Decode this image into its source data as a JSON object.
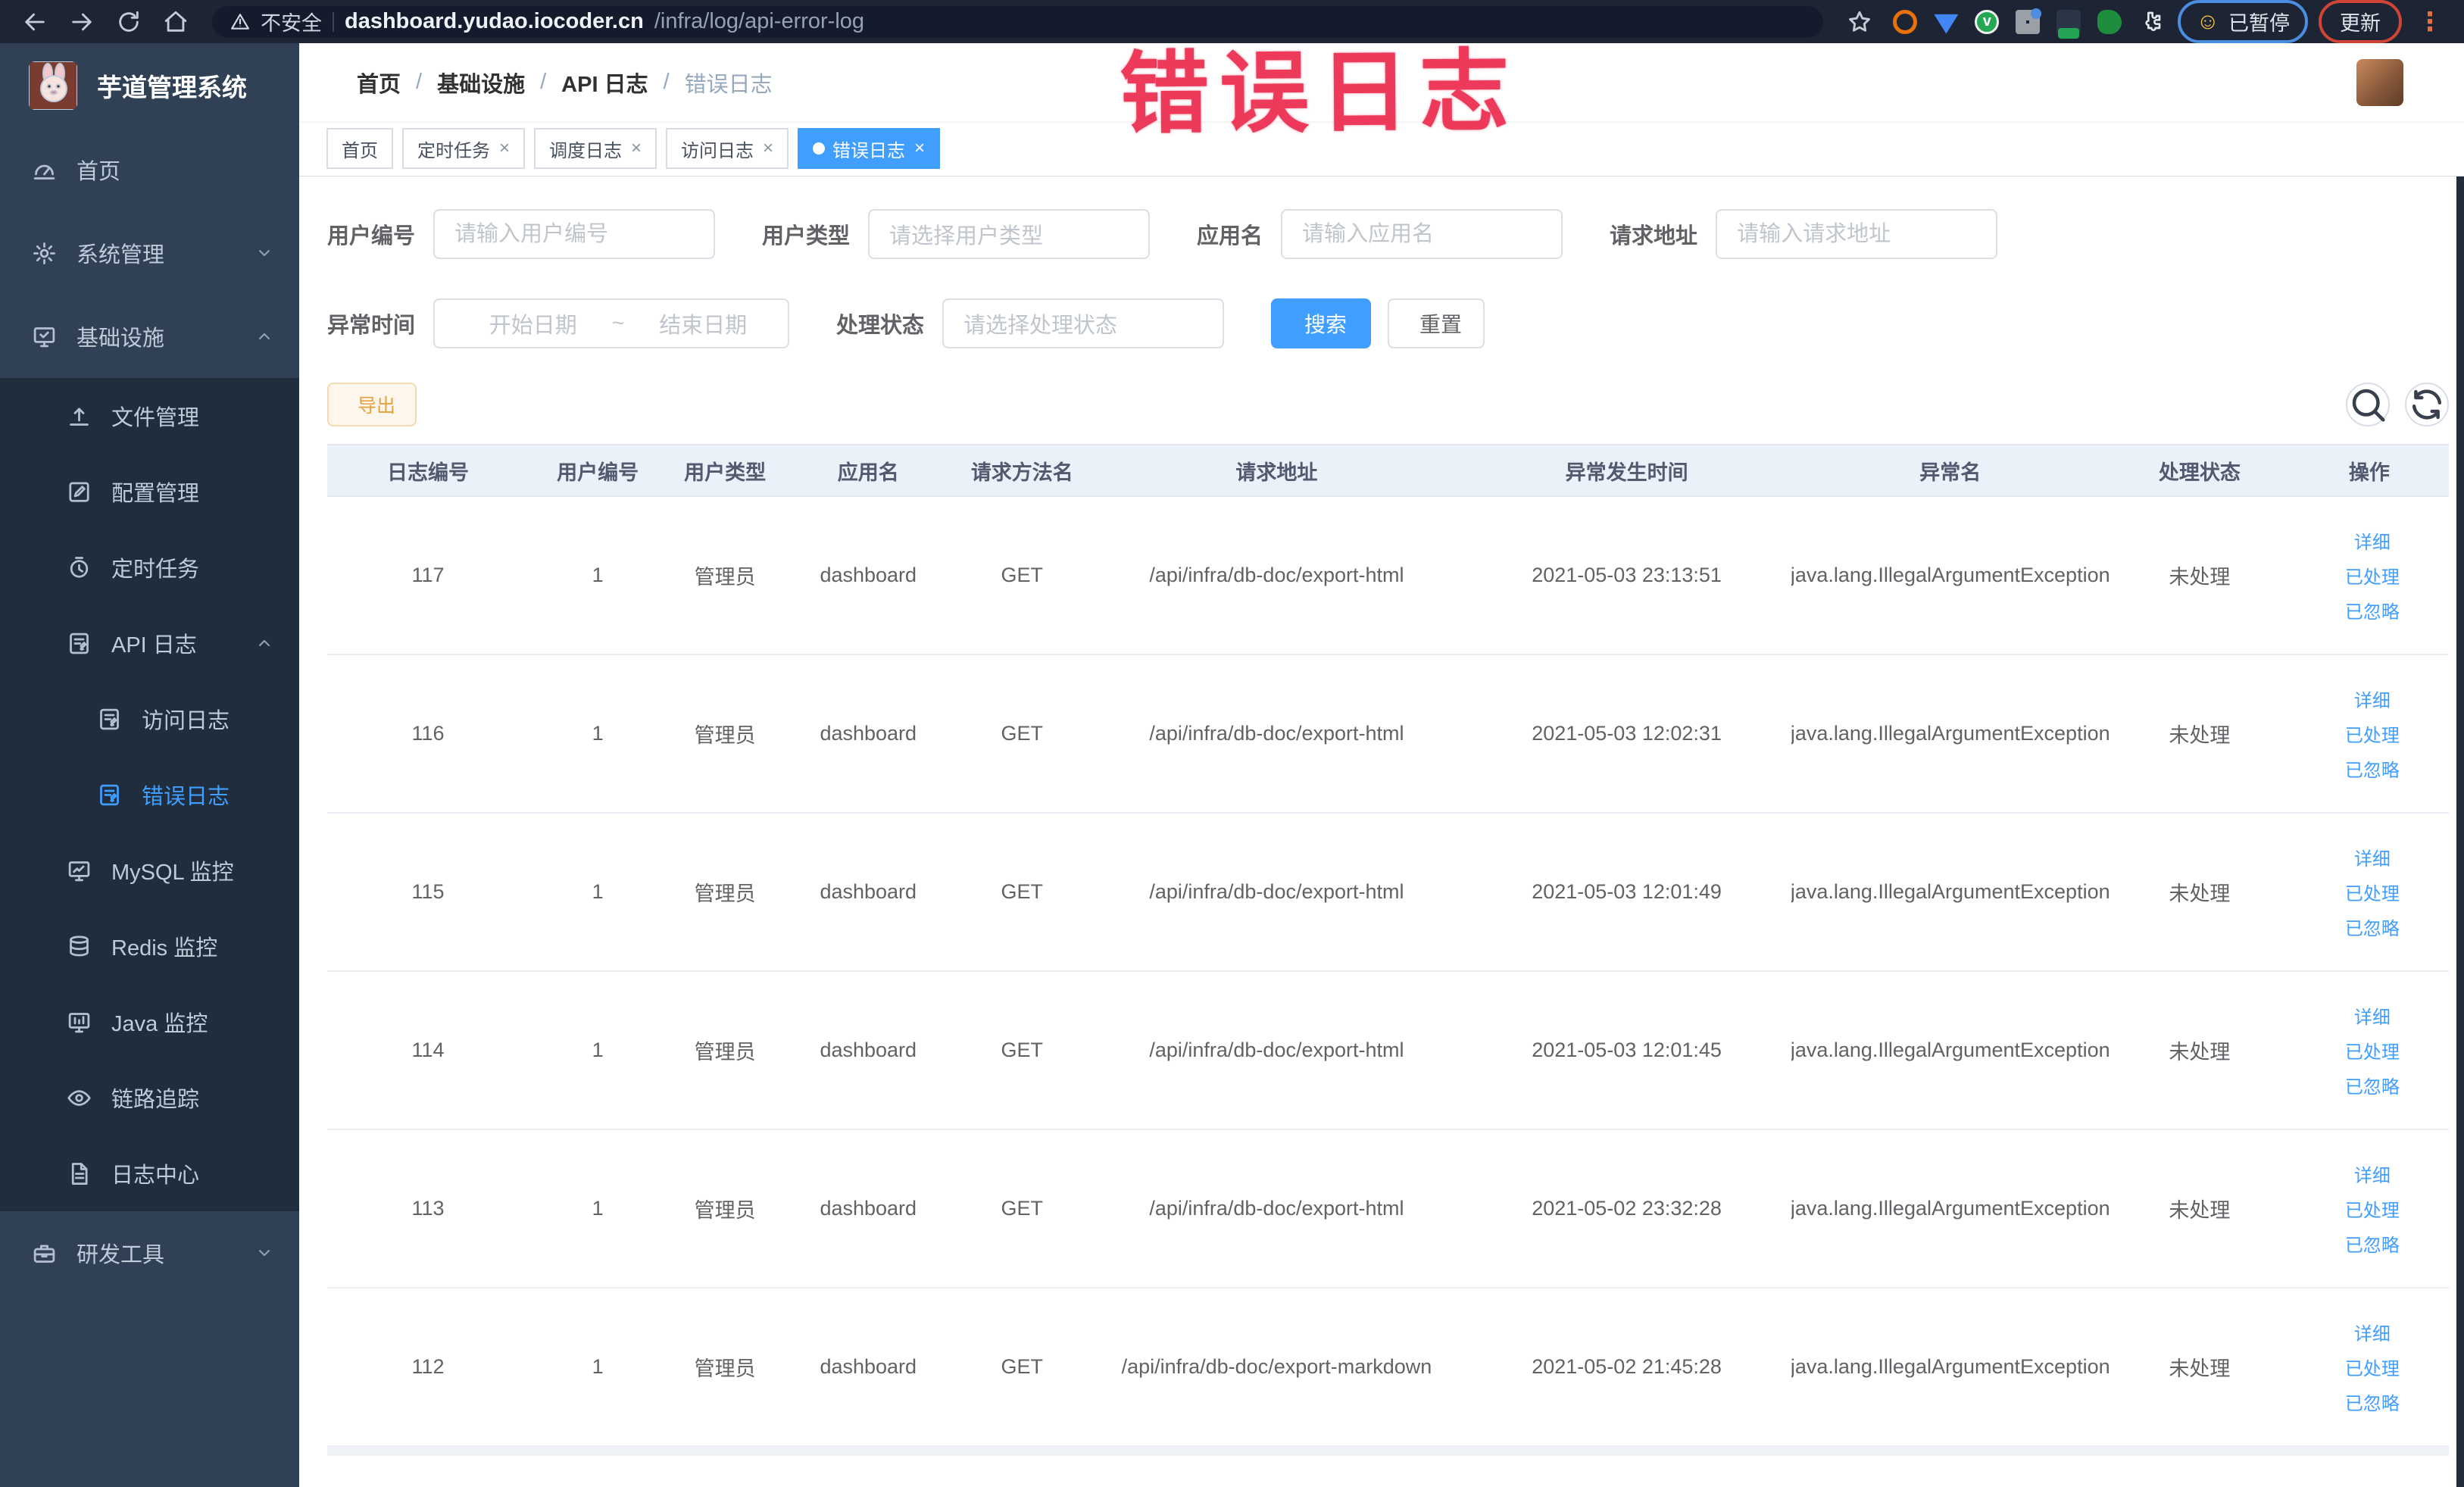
{
  "browser": {
    "security_label": "不安全",
    "url_host": "dashboard.yudao.iocoder.cn",
    "url_path": "/infra/log/api-error-log",
    "paused_emoji": "☺",
    "paused_label": "已暂停",
    "update_label": "更新",
    "kebab": "⋮"
  },
  "annotation": "错误日志",
  "colors": {
    "accent": "#409eff",
    "chrome_bg": "#1d2535",
    "sidebar_bg": "#304156",
    "sidebar_submenu_bg": "#1f2d3d",
    "sidebar_text": "#bfcbd9",
    "table_header_bg": "#ebf1f9",
    "export_bg": "#fdf6ec",
    "export_border": "#f5dab1",
    "export_text": "#e6a23c",
    "tag_active_bg": "#409eff",
    "annotation_color": "#ee3a5a"
  },
  "sidebar": {
    "app_title": "芋道管理系统",
    "items": [
      {
        "key": "home",
        "label": "首页",
        "icon": "dashboard-icon",
        "level": 1
      },
      {
        "key": "system",
        "label": "系统管理",
        "icon": "gear-icon",
        "level": 1,
        "chevron": "down"
      },
      {
        "key": "infra",
        "label": "基础设施",
        "icon": "monitor-icon",
        "level": 1,
        "chevron": "up"
      },
      {
        "key": "file",
        "label": "文件管理",
        "icon": "upload-icon",
        "level": 2,
        "dark": true
      },
      {
        "key": "config",
        "label": "配置管理",
        "icon": "edit-icon",
        "level": 2,
        "dark": true
      },
      {
        "key": "job",
        "label": "定时任务",
        "icon": "timer-icon",
        "level": 2,
        "dark": true
      },
      {
        "key": "api-log",
        "label": "API 日志",
        "icon": "log-icon",
        "level": 2,
        "dark": true,
        "chevron": "up"
      },
      {
        "key": "access-log",
        "label": "访问日志",
        "icon": "log-icon",
        "level": 3,
        "dark": true
      },
      {
        "key": "error-log",
        "label": "错误日志",
        "icon": "log-icon",
        "level": 3,
        "dark": true,
        "active": true
      },
      {
        "key": "mysql",
        "label": "MySQL 监控",
        "icon": "chart-icon",
        "level": 2,
        "dark": true
      },
      {
        "key": "redis",
        "label": "Redis 监控",
        "icon": "redis-icon",
        "level": 2,
        "dark": true
      },
      {
        "key": "java",
        "label": "Java 监控",
        "icon": "java-icon",
        "level": 2,
        "dark": true
      },
      {
        "key": "trace",
        "label": "链路追踪",
        "icon": "eye-icon",
        "level": 2,
        "dark": true
      },
      {
        "key": "log-center",
        "label": "日志中心",
        "icon": "doc-icon",
        "level": 2,
        "dark": true
      },
      {
        "key": "dev-tools",
        "label": "研发工具",
        "icon": "toolbox-icon",
        "level": 1,
        "chevron": "down"
      }
    ]
  },
  "breadcrumb": [
    "首页",
    "基础设施",
    "API 日志",
    "错误日志"
  ],
  "breadcrumb_separator": "/",
  "header_icons": [
    "search-icon",
    "github-icon",
    "docs-icon",
    "fullscreen-icon",
    "font-size-icon"
  ],
  "tags": [
    {
      "label": "首页"
    },
    {
      "label": "定时任务",
      "closable": true
    },
    {
      "label": "调度日志",
      "closable": true
    },
    {
      "label": "访问日志",
      "closable": true
    },
    {
      "label": "错误日志",
      "closable": true,
      "active": true
    }
  ],
  "search": {
    "fields": [
      {
        "label": "用户编号",
        "placeholder": "请输入用户编号"
      },
      {
        "label": "用户类型",
        "placeholder": "请选择用户类型"
      },
      {
        "label": "应用名",
        "placeholder": "请输入应用名"
      },
      {
        "label": "请求地址",
        "placeholder": "请输入请求地址"
      },
      {
        "label": "异常时间",
        "start_placeholder": "开始日期",
        "separator": "~",
        "end_placeholder": "结束日期"
      },
      {
        "label": "处理状态",
        "placeholder": "请选择处理状态"
      }
    ],
    "search_label": "搜索",
    "reset_label": "重置"
  },
  "toolbar": {
    "export_label": "导出"
  },
  "table": {
    "columns": [
      "日志编号",
      "用户编号",
      "用户类型",
      "应用名",
      "请求方法名",
      "请求地址",
      "异常发生时间",
      "异常名",
      "处理状态",
      "操作"
    ],
    "rows": [
      {
        "cells": [
          "117",
          "1",
          "管理员",
          "dashboard",
          "GET",
          "/api/infra/db-doc/export-html",
          "2021-05-03 23:13:51",
          "java.lang.IllegalArgumentException",
          "未处理"
        ]
      },
      {
        "cells": [
          "116",
          "1",
          "管理员",
          "dashboard",
          "GET",
          "/api/infra/db-doc/export-html",
          "2021-05-03 12:02:31",
          "java.lang.IllegalArgumentException",
          "未处理"
        ]
      },
      {
        "cells": [
          "115",
          "1",
          "管理员",
          "dashboard",
          "GET",
          "/api/infra/db-doc/export-html",
          "2021-05-03 12:01:49",
          "java.lang.IllegalArgumentException",
          "未处理"
        ]
      },
      {
        "cells": [
          "114",
          "1",
          "管理员",
          "dashboard",
          "GET",
          "/api/infra/db-doc/export-html",
          "2021-05-03 12:01:45",
          "java.lang.IllegalArgumentException",
          "未处理"
        ]
      },
      {
        "cells": [
          "113",
          "1",
          "管理员",
          "dashboard",
          "GET",
          "/api/infra/db-doc/export-html",
          "2021-05-02 23:32:28",
          "java.lang.IllegalArgumentException",
          "未处理"
        ]
      },
      {
        "cells": [
          "112",
          "1",
          "管理员",
          "dashboard",
          "GET",
          "/api/infra/db-doc/export-markdown",
          "2021-05-02 21:45:28",
          "java.lang.IllegalArgumentException",
          "未处理"
        ]
      }
    ],
    "actions": [
      {
        "label": "详细",
        "icon": "view-icon"
      },
      {
        "label": "已处理",
        "icon": "check-icon"
      },
      {
        "label": "已忽略",
        "icon": "check-icon"
      }
    ]
  }
}
